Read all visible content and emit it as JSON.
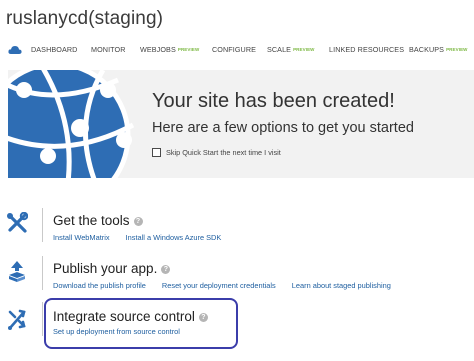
{
  "site": {
    "title": "ruslanycd(staging)"
  },
  "nav": {
    "items": [
      {
        "label": "DASHBOARD",
        "tag": ""
      },
      {
        "label": "MONITOR",
        "tag": ""
      },
      {
        "label": "WEBJOBS",
        "tag": "PREVIEW"
      },
      {
        "label": "CONFIGURE",
        "tag": ""
      },
      {
        "label": "SCALE",
        "tag": "PREVIEW"
      },
      {
        "label": "LINKED RESOURCES",
        "tag": ""
      },
      {
        "label": "BACKUPS",
        "tag": "PREVIEW"
      }
    ]
  },
  "hero": {
    "title": "Your site has been created!",
    "subtitle": "Here are a few options to get you started",
    "skip_label": "Skip Quick Start the next time I visit",
    "skip_checked": false
  },
  "sections": {
    "tools": {
      "title": "Get the tools",
      "links": [
        "Install WebMatrix",
        "Install a Windows Azure SDK"
      ]
    },
    "publish": {
      "title": "Publish your app.",
      "links": [
        "Download the publish profile",
        "Reset your deployment credentials",
        "Learn about staged publishing"
      ]
    },
    "source": {
      "title": "Integrate source control",
      "links": [
        "Set up deployment from source control"
      ]
    }
  },
  "colors": {
    "accent": "#1f5fa0",
    "preview_tag": "#7cb843",
    "icon_blue": "#2e6db4",
    "highlight": "#3b3daa"
  }
}
